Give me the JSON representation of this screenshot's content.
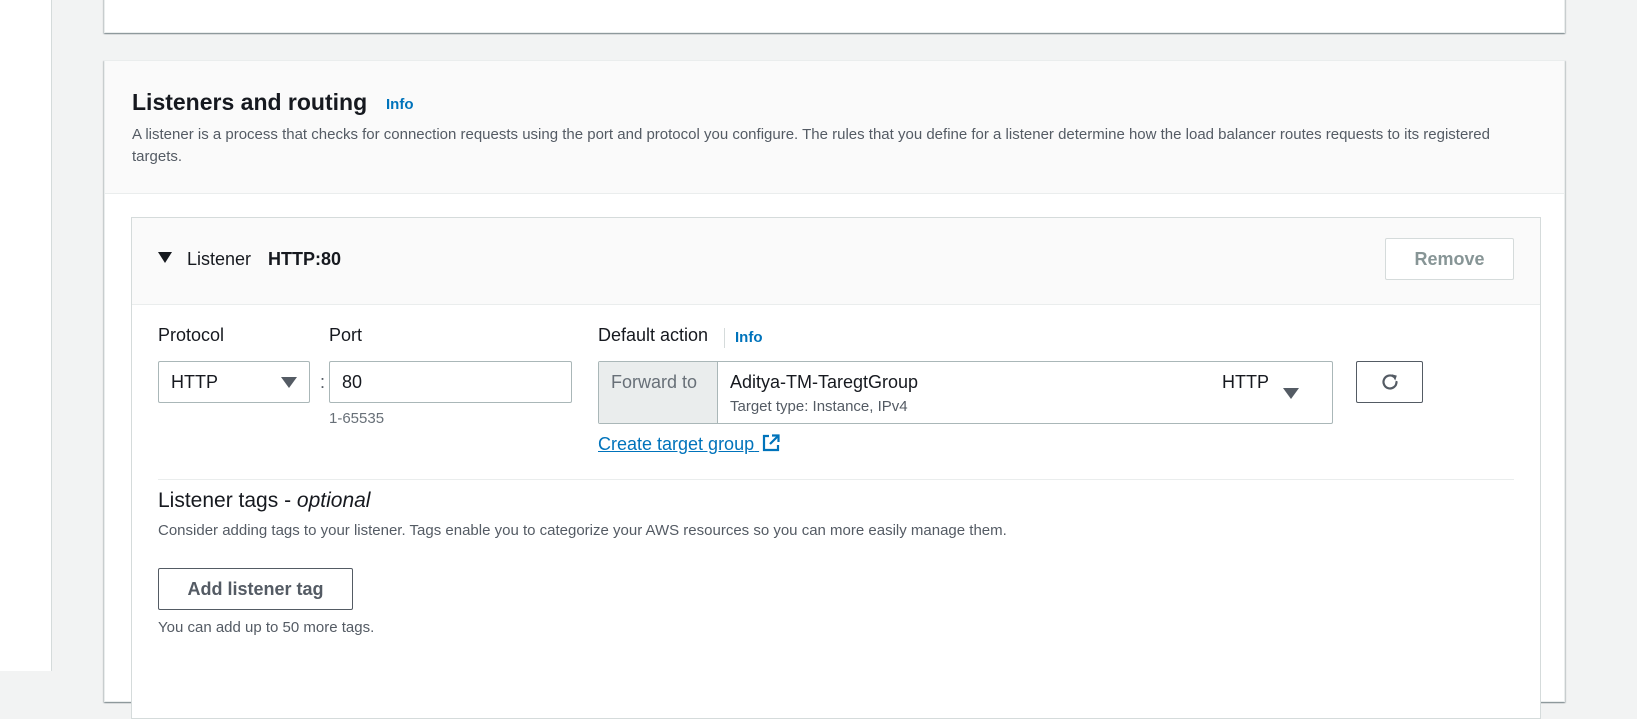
{
  "section": {
    "title": "Listeners and routing",
    "info_label": "Info",
    "description": "A listener is a process that checks for connection requests using the port and protocol you configure. The rules that you define for a listener determine how the load balancer routes requests to its registered targets."
  },
  "listener": {
    "label": "Listener",
    "value": "HTTP:80",
    "remove_label": "Remove",
    "protocol": {
      "label": "Protocol",
      "selected": "HTTP"
    },
    "separator": ":",
    "port": {
      "label": "Port",
      "value": "80",
      "hint": "1-65535"
    },
    "default_action": {
      "label": "Default action",
      "info_label": "Info",
      "prefix": "Forward to",
      "target_group_name": "Aditya-TM-TaregtGroup",
      "target_group_protocol": "HTTP",
      "target_group_type": "Target type: Instance, IPv4",
      "create_link": "Create target group"
    },
    "tags": {
      "title": "Listener tags - ",
      "title_suffix": "optional",
      "description": "Consider adding tags to your listener. Tags enable you to categorize your AWS resources so you can more easily manage them.",
      "add_label": "Add listener tag",
      "hint": "You can add up to 50 more tags."
    }
  },
  "icons": {
    "expand": "caret-down-icon",
    "dropdown": "dropdown-arrow-icon",
    "refresh": "refresh-icon",
    "external": "external-link-icon"
  },
  "colors": {
    "link": "#0073bb",
    "text": "#16191f",
    "secondary_text": "#545b64",
    "background": "#f2f3f3"
  }
}
